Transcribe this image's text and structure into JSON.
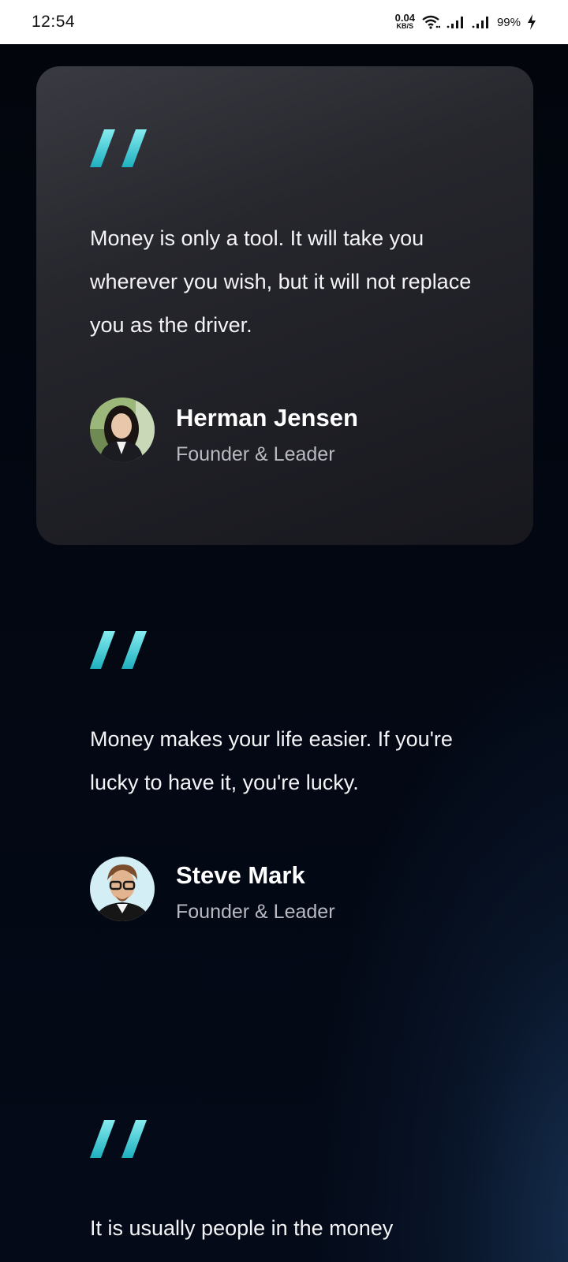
{
  "status_bar": {
    "time": "12:54",
    "net_speed_value": "0.04",
    "net_speed_unit": "KB/S",
    "battery": "99%",
    "icons": [
      "wifi-icon",
      "signal-icon",
      "signal-icon",
      "charging-icon"
    ]
  },
  "testimonials": [
    {
      "quote": "Money is only a tool. It will take you wherever you wish, but it will not replace you as the driver.",
      "name": "Herman Jensen",
      "role": "Founder & Leader",
      "avatar": "woman-portrait"
    },
    {
      "quote": "Money makes your life easier. If you're lucky to have it, you're lucky.",
      "name": "Steve Mark",
      "role": "Founder & Leader",
      "avatar": "man-portrait-glasses"
    },
    {
      "quote": "It is usually people in the money",
      "name": "",
      "role": ""
    }
  ],
  "colors": {
    "quote_accent_top": "#7fe6ea",
    "quote_accent_bottom": "#27b7c4",
    "card_bg": "#26262d",
    "page_bg": "#02050c"
  }
}
